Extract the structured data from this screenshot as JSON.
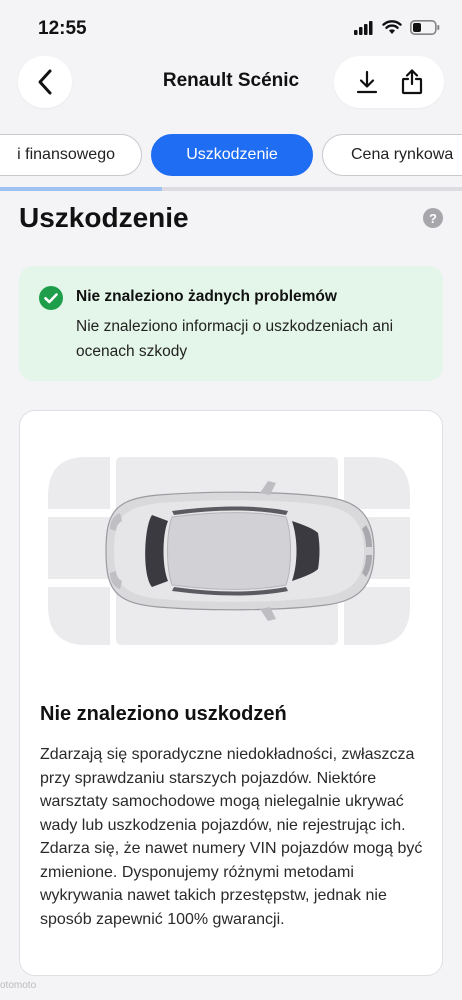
{
  "status_bar": {
    "time": "12:55"
  },
  "header": {
    "title": "Renault Scénic"
  },
  "tabs": [
    {
      "label": "i finansowego",
      "active": false
    },
    {
      "label": "Uszkodzenie",
      "active": true
    },
    {
      "label": "Cena rynkowa",
      "active": false
    }
  ],
  "tab_scroll_progress": 0.35,
  "section": {
    "title": "Uszkodzenie",
    "help_glyph": "?"
  },
  "alert": {
    "title": "Nie znaleziono żadnych problemów",
    "text": "Nie znaleziono informacji o uszkodzeniach ani ocenach szkody"
  },
  "card": {
    "title": "Nie znaleziono uszkodzeń",
    "text": "Zdarzają się sporadyczne niedokładności, zwłaszcza przy sprawdzaniu starszych pojazdów. Niektóre warsztaty samochodowe mogą nielegalnie ukrywać wady lub uszkodzenia pojazdów, nie rejestrując ich. Zdarza się, że nawet numery VIN pojazdów mogą być zmienione. Dysponujemy różnymi metodami wykrywania nawet takich przestępstw, jednak nie sposób zapewnić 100% gwarancji."
  },
  "colors": {
    "accent": "#1f6df2",
    "success_bg": "#e4f6e9",
    "success_icon": "#1e9e4a",
    "zone": "#ebebed"
  },
  "icons": [
    "back-chevron-icon",
    "download-icon",
    "share-icon",
    "help-icon",
    "check-circle-icon",
    "signal-icon",
    "wifi-icon",
    "battery-icon"
  ],
  "watermark": "otomoto"
}
